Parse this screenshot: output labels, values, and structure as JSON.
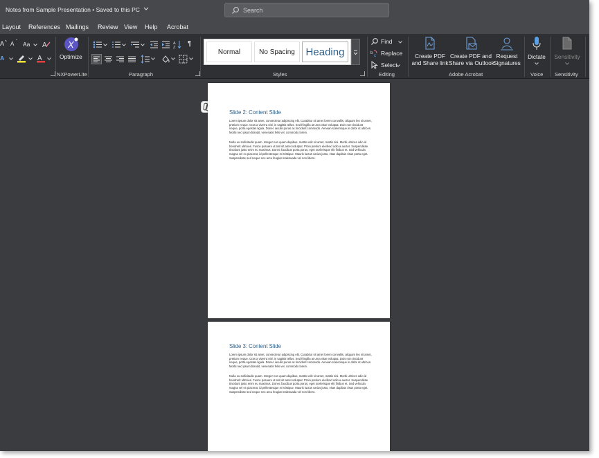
{
  "titlebar": {
    "document_title": "Notes from Sample Presentation",
    "save_status": "Saved to this PC"
  },
  "search": {
    "placeholder": "Search"
  },
  "menu": [
    "Layout",
    "References",
    "Mailings",
    "Review",
    "View",
    "Help",
    "Acrobat"
  ],
  "ribbon": {
    "font": {
      "grow": "A",
      "shrink": "A",
      "case": "Aa"
    },
    "nxpowerlite": {
      "optimize_label": "Optimize",
      "group_label": "NXPowerLite"
    },
    "paragraph": {
      "group_label": "Paragraph",
      "pilcrow": "¶"
    },
    "styles": {
      "group_label": "Styles",
      "items": [
        {
          "label": "Normal"
        },
        {
          "label": "No Spacing"
        },
        {
          "label": "Heading"
        }
      ]
    },
    "editing": {
      "group_label": "Editing",
      "find": "Find",
      "replace": "Replace",
      "select": "Select"
    },
    "acrobat": {
      "group_label": "Adobe Acrobat",
      "create_share_link_1": "Create PDF",
      "create_share_link_2": "and Share link",
      "create_share_outlook_1": "Create PDF and",
      "create_share_outlook_2": "Share via Outlook",
      "request_signatures_1": "Request",
      "request_signatures_2": "Signatures"
    },
    "voice": {
      "group_label": "Voice",
      "dictate": "Dictate"
    },
    "sensitivity": {
      "group_label": "Sensitivity",
      "button": "Sensitivity"
    }
  },
  "document": {
    "pages": [
      {
        "title": "Slide 2: Content Slide",
        "paragraphs": [
          "Lorem ipsum dolor sit amet, consectetur adipiscing elit. Curabitur sit amet lorem convallis, aliquam leo sit amet, pretium neque. Cras a viverra nisl, in sagittis tellus. Sed fringilla at urna vitae volutpat. Duis non tincidunt neque, porta egestas ligula. Donec iaculis purus ac tincidunt commodo. Aenean scelerisque in dolor ut ultrices. Morbi nec ipsum blandit, venenatis felis vel, commodo lorem.",
          "Nulla eu sollicitudin quam. Integer non quam dapibus, mattis velit sit amet, mattis nisi. Morbi ultrices odio id hendrerit ultricies. Fusce posuere ut nisl sit amet volutpat. Proin pretium eleifend odio a auctor. Suspendisse tincidunt justo enim eu maximus. Donec faucibus porta purus, eget scelerisque elit finibus et. Sed vehicula magna vel ex placerat, id pellentesque mi tristique. Mauris luctus varius justo, vitae dapibus risus porta eget. Suspendisse sed neque nec arcu feugiat malesuada vel non libero."
        ]
      },
      {
        "title": "Slide 3: Content Slide",
        "paragraphs": [
          "Lorem ipsum dolor sit amet, consectetur adipiscing elit. Curabitur sit amet lorem convallis, aliquam leo sit amet, pretium neque. Cras a viverra nisl, in sagittis tellus. Sed fringilla at urna vitae volutpat. Duis non tincidunt neque, porta egestas ligula. Donec iaculis purus ac tincidunt commodo. Aenean scelerisque in dolor ut ultrices. Morbi nec ipsum blandit, venenatis felis vel, commodo lorem.",
          "Nulla eu sollicitudin quam. Integer non quam dapibus, mattis velit sit amet, mattis nisi. Morbi ultrices odio id hendrerit ultricies. Fusce posuere ut nisl sit amet volutpat. Proin pretium eleifend odio a auctor. Suspendisse tincidunt justo enim eu maximus. Donec faucibus porta purus, eget scelerisque elit finibus et. Sed vehicula magna vel ex placerat, id pellentesque mi tristique. Mauris luctus varius justo, vitae dapibus risus porta eget. Suspendisse sed neque nec arcu feugiat malesuada vel non libero."
        ]
      }
    ]
  },
  "colors": {
    "heading_blue": "#2f5f86",
    "acrobat_blue": "#6f9fd8",
    "dictate_blue": "#5aa0e6",
    "optimize_purple": "#5c55c4"
  },
  "icons": {
    "titlebar_dropdown": "chevron-down-icon",
    "search": "search-icon",
    "copilot": "copilot-icon",
    "find": "search-icon",
    "replace": "replace-icon",
    "select": "cursor-icon"
  }
}
